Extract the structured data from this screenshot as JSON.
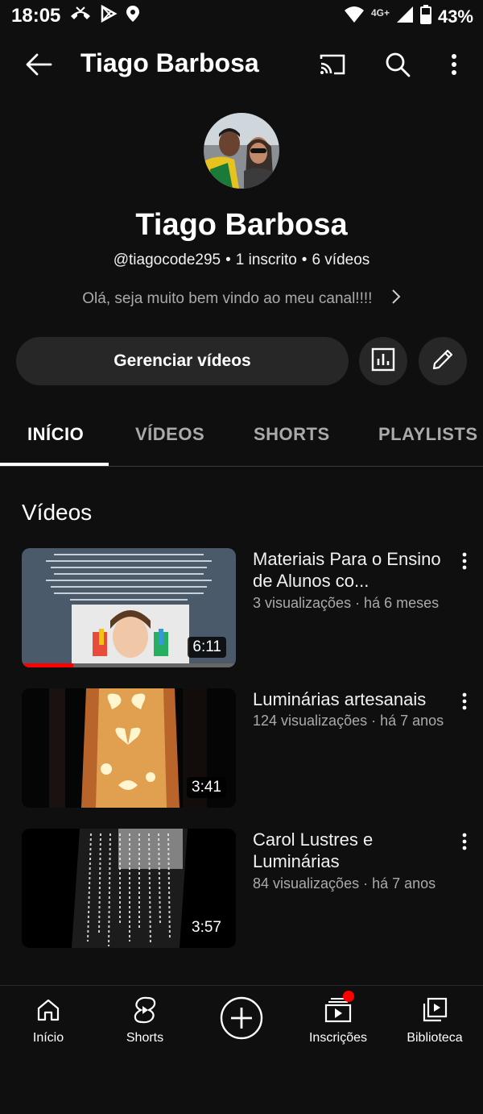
{
  "status_bar": {
    "time": "18:05",
    "network": "4G+",
    "battery": "43%"
  },
  "top_bar": {
    "title": "Tiago Barbosa",
    "icons": [
      "back-arrow-icon",
      "cast-icon",
      "search-icon",
      "more-vert-icon"
    ]
  },
  "channel": {
    "name": "Tiago Barbosa",
    "handle": "@tiagocode295",
    "subscribers": "1 inscrito",
    "video_count": "6 vídeos",
    "description": "Olá, seja muito bem vindo ao meu canal!!!!",
    "manage_label": "Gerenciar vídeos"
  },
  "tabs": [
    {
      "label": "INÍCIO",
      "active": true
    },
    {
      "label": "VÍDEOS",
      "active": false
    },
    {
      "label": "SHORTS",
      "active": false
    },
    {
      "label": "PLAYLISTS",
      "active": false
    }
  ],
  "section": {
    "title": "Vídeos"
  },
  "videos": [
    {
      "title": "Materiais Para o Ensino de Alunos co...",
      "meta": "3 visualizações · há 6 meses",
      "duration": "6:11",
      "watched_fraction": 0.24
    },
    {
      "title": "Luminárias artesanais",
      "meta": "124 visualizações · há 7 anos",
      "duration": "3:41"
    },
    {
      "title": "Carol Lustres e Luminárias",
      "meta": "84 visualizações · há 7 anos",
      "duration": "3:57"
    }
  ],
  "bottom_nav": [
    {
      "label": "Início",
      "icon": "home-icon"
    },
    {
      "label": "Shorts",
      "icon": "shorts-icon"
    },
    {
      "label": "",
      "icon": "create-plus-icon"
    },
    {
      "label": "Inscrições",
      "icon": "subscriptions-icon",
      "badge": true
    },
    {
      "label": "Biblioteca",
      "icon": "library-icon"
    }
  ],
  "colors": {
    "background": "#0f0f0f",
    "button_bg": "#272727",
    "accent_red": "#ff0000",
    "muted_text": "#aaaaaa"
  }
}
